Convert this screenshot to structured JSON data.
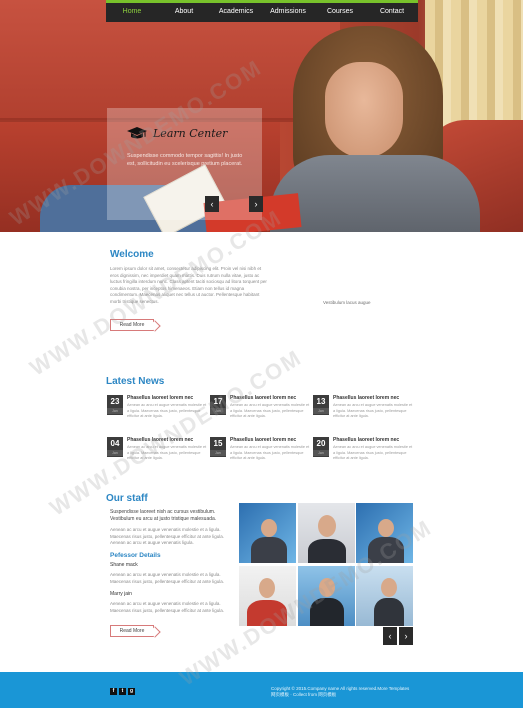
{
  "nav": {
    "items": [
      {
        "label": "Home",
        "active": true
      },
      {
        "label": "About",
        "active": false
      },
      {
        "label": "Academics",
        "active": false
      },
      {
        "label": "Admissions",
        "active": false
      },
      {
        "label": "Courses",
        "active": false
      },
      {
        "label": "Contact",
        "active": false
      }
    ],
    "accent": "#78c22b"
  },
  "hero": {
    "logo_icon": "graduation-cap-icon",
    "title": "Learn Center",
    "text": "Suspendisse commodo tempor sagittis! In justo est, sollicitudin eu scelerisque pretium placerat.",
    "prev": "‹",
    "next": "›"
  },
  "welcome": {
    "title": "Welcome",
    "text": "Lorem ipsum dolor sit amet, consectetur adipiscing elit. Proin vel nisi nibh et eros dignissim, nec imperdiet quam mattis. Duis rutrum nulla vitae, justo ac luctus fringilla interdum nunc. Class aptent taciti sociosqu ad litora torquent per conubia nostra, per inceptos himenaeos. Etiam non tellus id magna condimentum. Maecenas aliquet nec tellus ut auctor. Pellentesque habitant morbi tristique senectus.",
    "caption": "Vestibulum lacus augue",
    "button": "Read More"
  },
  "news": {
    "title": "Latest News",
    "items": [
      {
        "day": "23",
        "month": "Jan",
        "title": "Phasellus laoreet lorem nec",
        "text": "Aenean ac arcu et augue venenatis molestie et a ligula. Maecenas risus justo, pellentesque efficitur at ante ligula."
      },
      {
        "day": "17",
        "month": "Jan",
        "title": "Phasellus laoreet lorem nec",
        "text": "Aenean ac arcu et augue venenatis molestie et a ligula. Maecenas risus justo, pellentesque efficitur at ante ligula."
      },
      {
        "day": "13",
        "month": "Jan",
        "title": "Phasellus laoreet lorem nec",
        "text": "Aenean ac arcu et augue venenatis molestie et a ligula. Maecenas risus justo, pellentesque efficitur at ante ligula."
      },
      {
        "day": "04",
        "month": "Jan",
        "title": "Phasellus laoreet lorem nec",
        "text": "Aenean ac arcu et augue venenatis molestie et a ligula. Maecenas risus justo, pellentesque efficitur at ante ligula."
      },
      {
        "day": "15",
        "month": "Jan",
        "title": "Phasellus laoreet lorem nec",
        "text": "Aenean ac arcu et augue venenatis molestie et a ligula. Maecenas risus justo, pellentesque efficitur at ante ligula."
      },
      {
        "day": "20",
        "month": "Jan",
        "title": "Phasellus laoreet lorem nec",
        "text": "Aenean ac arcu et augue venenatis molestie et a ligula. Maecenas risus justo, pellentesque efficitur at ante ligula."
      }
    ]
  },
  "staff": {
    "title": "Our staff",
    "subtitle": "Suspendisse laoreet nish ac cursus vestibulum. Vestibulum eu arcu at justo tristique malesuada.",
    "intro": "Aenean ac arcu et augue venenatis molestie et a ligula. Maecenas risus justo, pellentesque efficitur at ante ligula. Aenean ac arcu et augue venenatis ligula.",
    "section_title": "Pefessor Details",
    "people": [
      {
        "name": "Shane mack",
        "text": "Aenean ac arcu et augue venenatis molestie et a ligula. Maecenas risus justo, pellentesque efficitur at ante ligula."
      },
      {
        "name": "Marry jain",
        "text": "Aenean ac arcu et augue venenatis molestie et a ligula. Maecenas risus justo, pellentesque efficitur at ante ligula."
      }
    ],
    "button": "Read More",
    "prev": "‹",
    "next": "›"
  },
  "footer": {
    "social": [
      "f",
      "t",
      "g"
    ],
    "copyright": "Copyright © 2015.Company name All rights reserved.More Templates",
    "links": "网页模板 · Collect from 网页模板",
    "color": "#1a96d6"
  },
  "watermark": {
    "text": "WWW.DOWNDEMO.COM"
  }
}
